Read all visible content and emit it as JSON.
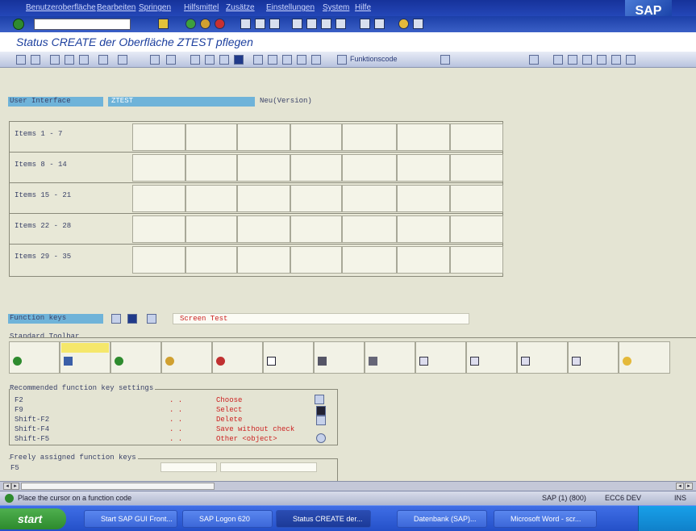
{
  "menubar": {
    "items": [
      "Benutzeroberfläche",
      "Bearbeiten",
      "Springen",
      "Hilfsmittel",
      "Zusätze",
      "Einstellungen",
      "System",
      "Hilfe"
    ]
  },
  "window": {
    "title": "Status CREATE der Oberfläche ZTEST pflegen"
  },
  "app_toolbar": {
    "function_code_label": "Funktionscode",
    "buttons": [
      "Funktionscode",
      "Dokumentation",
      "Pfeil hoch",
      "Pfeil runter"
    ]
  },
  "user_interface": {
    "label": "User Interface",
    "value": "ZTEST",
    "status": "Neu(Version)"
  },
  "items": {
    "rows": [
      "Items  1 - 7",
      "Items  8 - 14",
      "Items 15 - 21",
      "Items 22 - 28",
      "Items 29 - 35"
    ]
  },
  "function_keys": {
    "label": "Function keys",
    "value": "Screen Test"
  },
  "standard_toolbar": {
    "label": "Standard Toolbar",
    "icons": [
      "enter-icon",
      "save-icon",
      "back-icon",
      "exit-icon",
      "cancel-icon",
      "print-icon",
      "find-icon",
      "find-next-icon",
      "first-page-icon",
      "previous-page-icon",
      "next-page-icon",
      "last-page-icon",
      "help-icon"
    ]
  },
  "recommended": {
    "label": "Recommended function key settings",
    "rows": [
      {
        "key": "F2",
        "sep": ". .",
        "text": "Choose"
      },
      {
        "key": "F9",
        "sep": ". .",
        "text": "Select"
      },
      {
        "key": "Shift-F2",
        "sep": ". .",
        "text": "Delete"
      },
      {
        "key": "Shift-F4",
        "sep": ". .",
        "text": "Save without check"
      },
      {
        "key": "Shift-F5",
        "sep": ". .",
        "text": "Other <object>"
      }
    ]
  },
  "freely_assigned": {
    "label": "Freely assigned function keys",
    "first_key": "F5"
  },
  "status": {
    "message": "Place the cursor on a function code",
    "system": "SAP (1) (800)",
    "client": "ECC6 DEV",
    "mode": "INS"
  },
  "taskbar": {
    "start_label": "start",
    "tasks": [
      "Start SAP GUI Front...",
      "SAP Logon 620",
      "Status CREATE der...",
      "Datenbank (SAP)...",
      "Microsoft Word - scr..."
    ]
  },
  "colors": {
    "title_blue": "#1c3f9e",
    "menubar_blue": "#16329a",
    "highlight": "#6fb3d9",
    "red_text": "#cc2222"
  }
}
